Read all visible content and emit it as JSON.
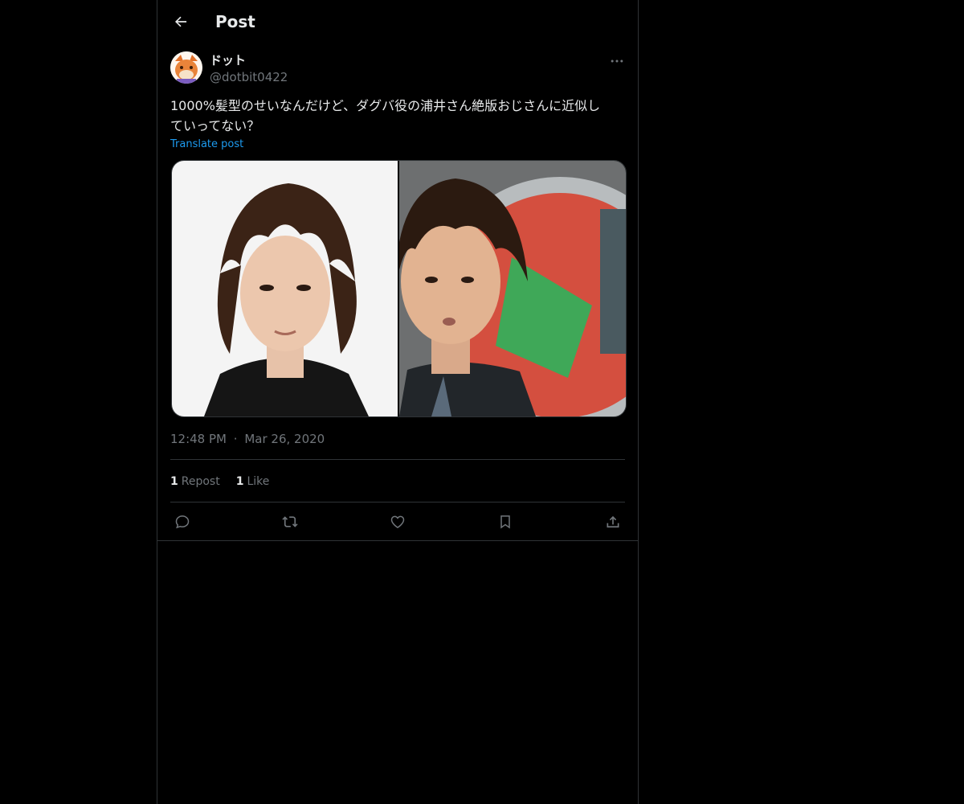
{
  "header": {
    "title": "Post"
  },
  "post": {
    "author": {
      "display_name": "ドット",
      "handle": "@dotbit0422"
    },
    "text": "1000%髪型のせいなんだけど、ダグバ役の浦井さん絶版おじさんに近似し\nていってない？",
    "translate_label": "Translate post",
    "time": "12:48 PM",
    "separator": "·",
    "date": "Mar 26, 2020",
    "stats": {
      "reposts_count": "1",
      "reposts_label": "Repost",
      "likes_count": "1",
      "likes_label": "Like"
    }
  },
  "icons": {
    "back": "arrow-left-icon",
    "more": "more-horizontal-icon",
    "reply": "reply-icon",
    "repost": "repost-icon",
    "like": "heart-icon",
    "bookmark": "bookmark-icon",
    "share": "share-icon"
  },
  "colors": {
    "background": "#000000",
    "text": "#e7e9ea",
    "secondary_text": "#71767b",
    "accent": "#1d9bf0",
    "border": "#2f3336"
  }
}
